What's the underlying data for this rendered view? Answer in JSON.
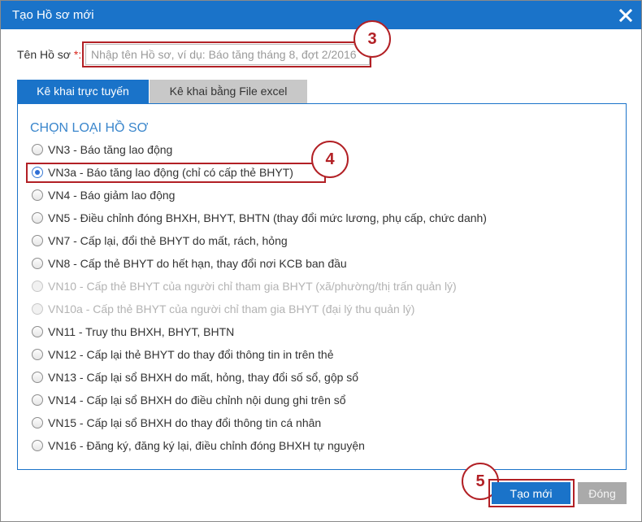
{
  "dialog": {
    "title": "Tạo Hồ sơ mới",
    "close_icon": "close-icon"
  },
  "name_field": {
    "label": "Tên Hồ sơ",
    "required_mark": "*:",
    "placeholder": "Nhập tên Hồ sơ, ví dụ: Báo tăng tháng 8, đợt 2/2016",
    "value": ""
  },
  "tabs": [
    {
      "label": "Kê khai trực tuyến",
      "active": true
    },
    {
      "label": "Kê khai bằng File excel",
      "active": false
    }
  ],
  "section_title": "CHỌN LOẠI HỒ SƠ",
  "options": [
    {
      "label": "VN3 - Báo tăng lao động",
      "checked": false,
      "disabled": false
    },
    {
      "label": "VN3a - Báo tăng lao động (chỉ có cấp thẻ BHYT)",
      "checked": true,
      "disabled": false
    },
    {
      "label": "VN4 - Báo giảm lao động",
      "checked": false,
      "disabled": false
    },
    {
      "label": "VN5 - Điều chỉnh đóng BHXH, BHYT, BHTN (thay đổi mức lương, phụ cấp, chức danh)",
      "checked": false,
      "disabled": false
    },
    {
      "label": "VN7 - Cấp lại, đổi thẻ BHYT do mất, rách, hỏng",
      "checked": false,
      "disabled": false
    },
    {
      "label": "VN8 - Cấp thẻ BHYT do hết hạn, thay đổi nơi KCB ban đầu",
      "checked": false,
      "disabled": false
    },
    {
      "label": "VN10 - Cấp thẻ BHYT của người chỉ tham gia BHYT (xã/phường/thị trấn quản lý)",
      "checked": false,
      "disabled": true
    },
    {
      "label": "VN10a - Cấp thẻ BHYT của người chỉ tham gia BHYT (đại lý thu quản lý)",
      "checked": false,
      "disabled": true
    },
    {
      "label": "VN11 - Truy thu BHXH, BHYT, BHTN",
      "checked": false,
      "disabled": false
    },
    {
      "label": "VN12 - Cấp lại thẻ BHYT do thay đổi thông tin in trên thẻ",
      "checked": false,
      "disabled": false
    },
    {
      "label": "VN13 - Cấp lại sổ BHXH do mất, hỏng, thay đổi số sổ, gộp sổ",
      "checked": false,
      "disabled": false
    },
    {
      "label": "VN14 - Cấp lại sổ BHXH do điều chỉnh nội dung ghi trên sổ",
      "checked": false,
      "disabled": false
    },
    {
      "label": "VN15 - Cấp lại sổ BHXH do thay đổi thông tin cá nhân",
      "checked": false,
      "disabled": false
    },
    {
      "label": "VN16 - Đăng ký, đăng ký lại, điều chỉnh đóng BHXH tự nguyện",
      "checked": false,
      "disabled": false
    }
  ],
  "callouts": [
    "3",
    "4",
    "5"
  ],
  "buttons": {
    "create": "Tạo mới",
    "close": "Đóng"
  },
  "colors": {
    "primary": "#1a73c9",
    "highlight": "#b22025",
    "section_title": "#3a86cc"
  }
}
